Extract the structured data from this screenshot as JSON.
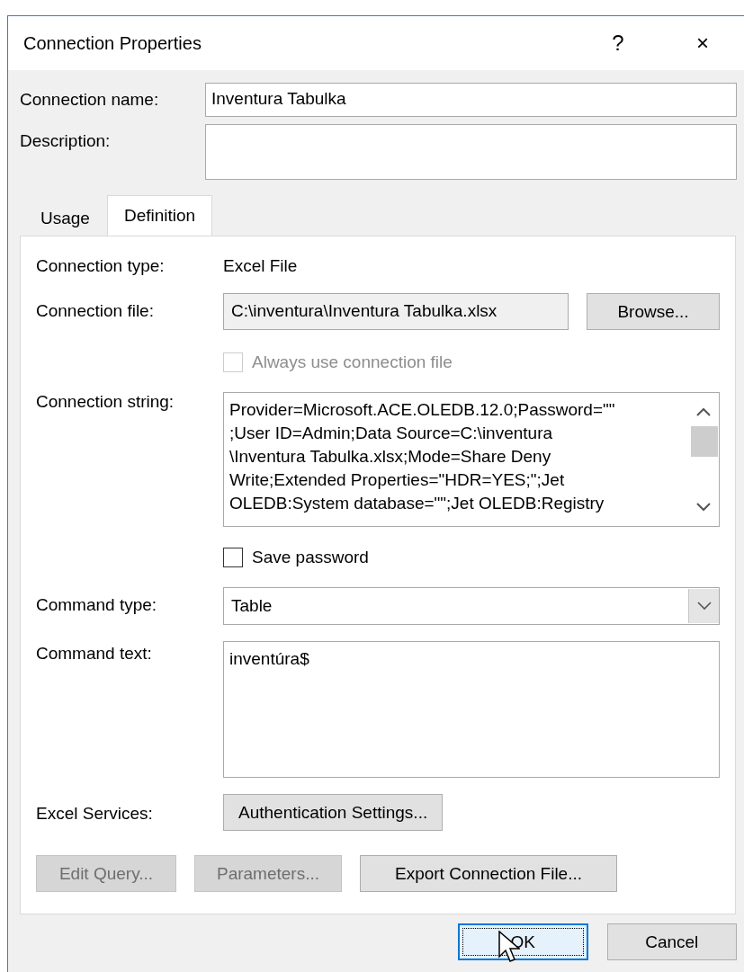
{
  "window": {
    "title": "Connection Properties",
    "help": "?",
    "close": "×"
  },
  "fields": [
    {
      "kind": "single",
      "label": "Connection name:",
      "value": "Inventura Tabulka"
    },
    {
      "kind": "multi",
      "label": "Description:"
    }
  ],
  "tabs": [
    {
      "label": "Usage",
      "selected": false
    },
    {
      "label": "Definition",
      "selected": true
    }
  ],
  "definition": {
    "rows": [
      {
        "kind": "text",
        "label": "Connection type:",
        "value": "Excel File"
      },
      {
        "kind": "file",
        "label": "Connection file:",
        "value": "C:\\inventura\\Inventura Tabulka.xlsx",
        "button": "Browse..."
      },
      {
        "kind": "checkbox",
        "text": "Always use connection file",
        "checked": false,
        "disabled": true
      },
      {
        "kind": "memo",
        "label": "Connection string:",
        "lines": [
          "Provider=Microsoft.ACE.OLEDB.12.0;Password=\"\"",
          ";User ID=Admin;Data Source=C:\\inventura",
          "\\Inventura Tabulka.xlsx;Mode=Share Deny",
          "Write;Extended Properties=\"HDR=YES;\";Jet",
          "OLEDB:System database=\"\";Jet OLEDB:Registry"
        ]
      },
      {
        "kind": "checkbox",
        "text": "Save password",
        "checked": false,
        "disabled": false
      },
      {
        "kind": "select",
        "label": "Command type:",
        "value": "Table"
      },
      {
        "kind": "textarea",
        "label": "Command text:",
        "lines": [
          "inventúra$"
        ]
      },
      {
        "kind": "button",
        "label": "Excel Services:",
        "button": "Authentication Settings..."
      }
    ],
    "buttons": [
      {
        "label": "Edit Query...",
        "disabled": true
      },
      {
        "label": "Parameters...",
        "disabled": true
      },
      {
        "label": "Export Connection File...",
        "disabled": false
      }
    ]
  },
  "footer_buttons": [
    {
      "label": "OK",
      "default": true
    },
    {
      "label": "Cancel",
      "default": false
    }
  ]
}
